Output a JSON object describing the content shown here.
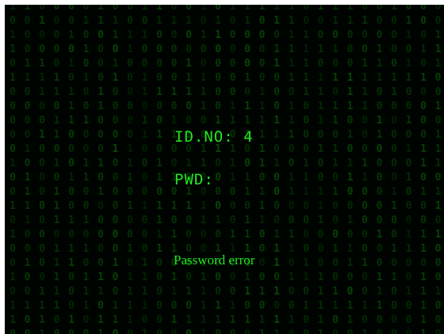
{
  "login": {
    "id_label": "ID.NO:",
    "id_value": "4",
    "pwd_label": "PWD:",
    "pwd_value": "",
    "message": "Password error"
  },
  "theme": {
    "background": "#000400",
    "text_color": "#22e622"
  }
}
